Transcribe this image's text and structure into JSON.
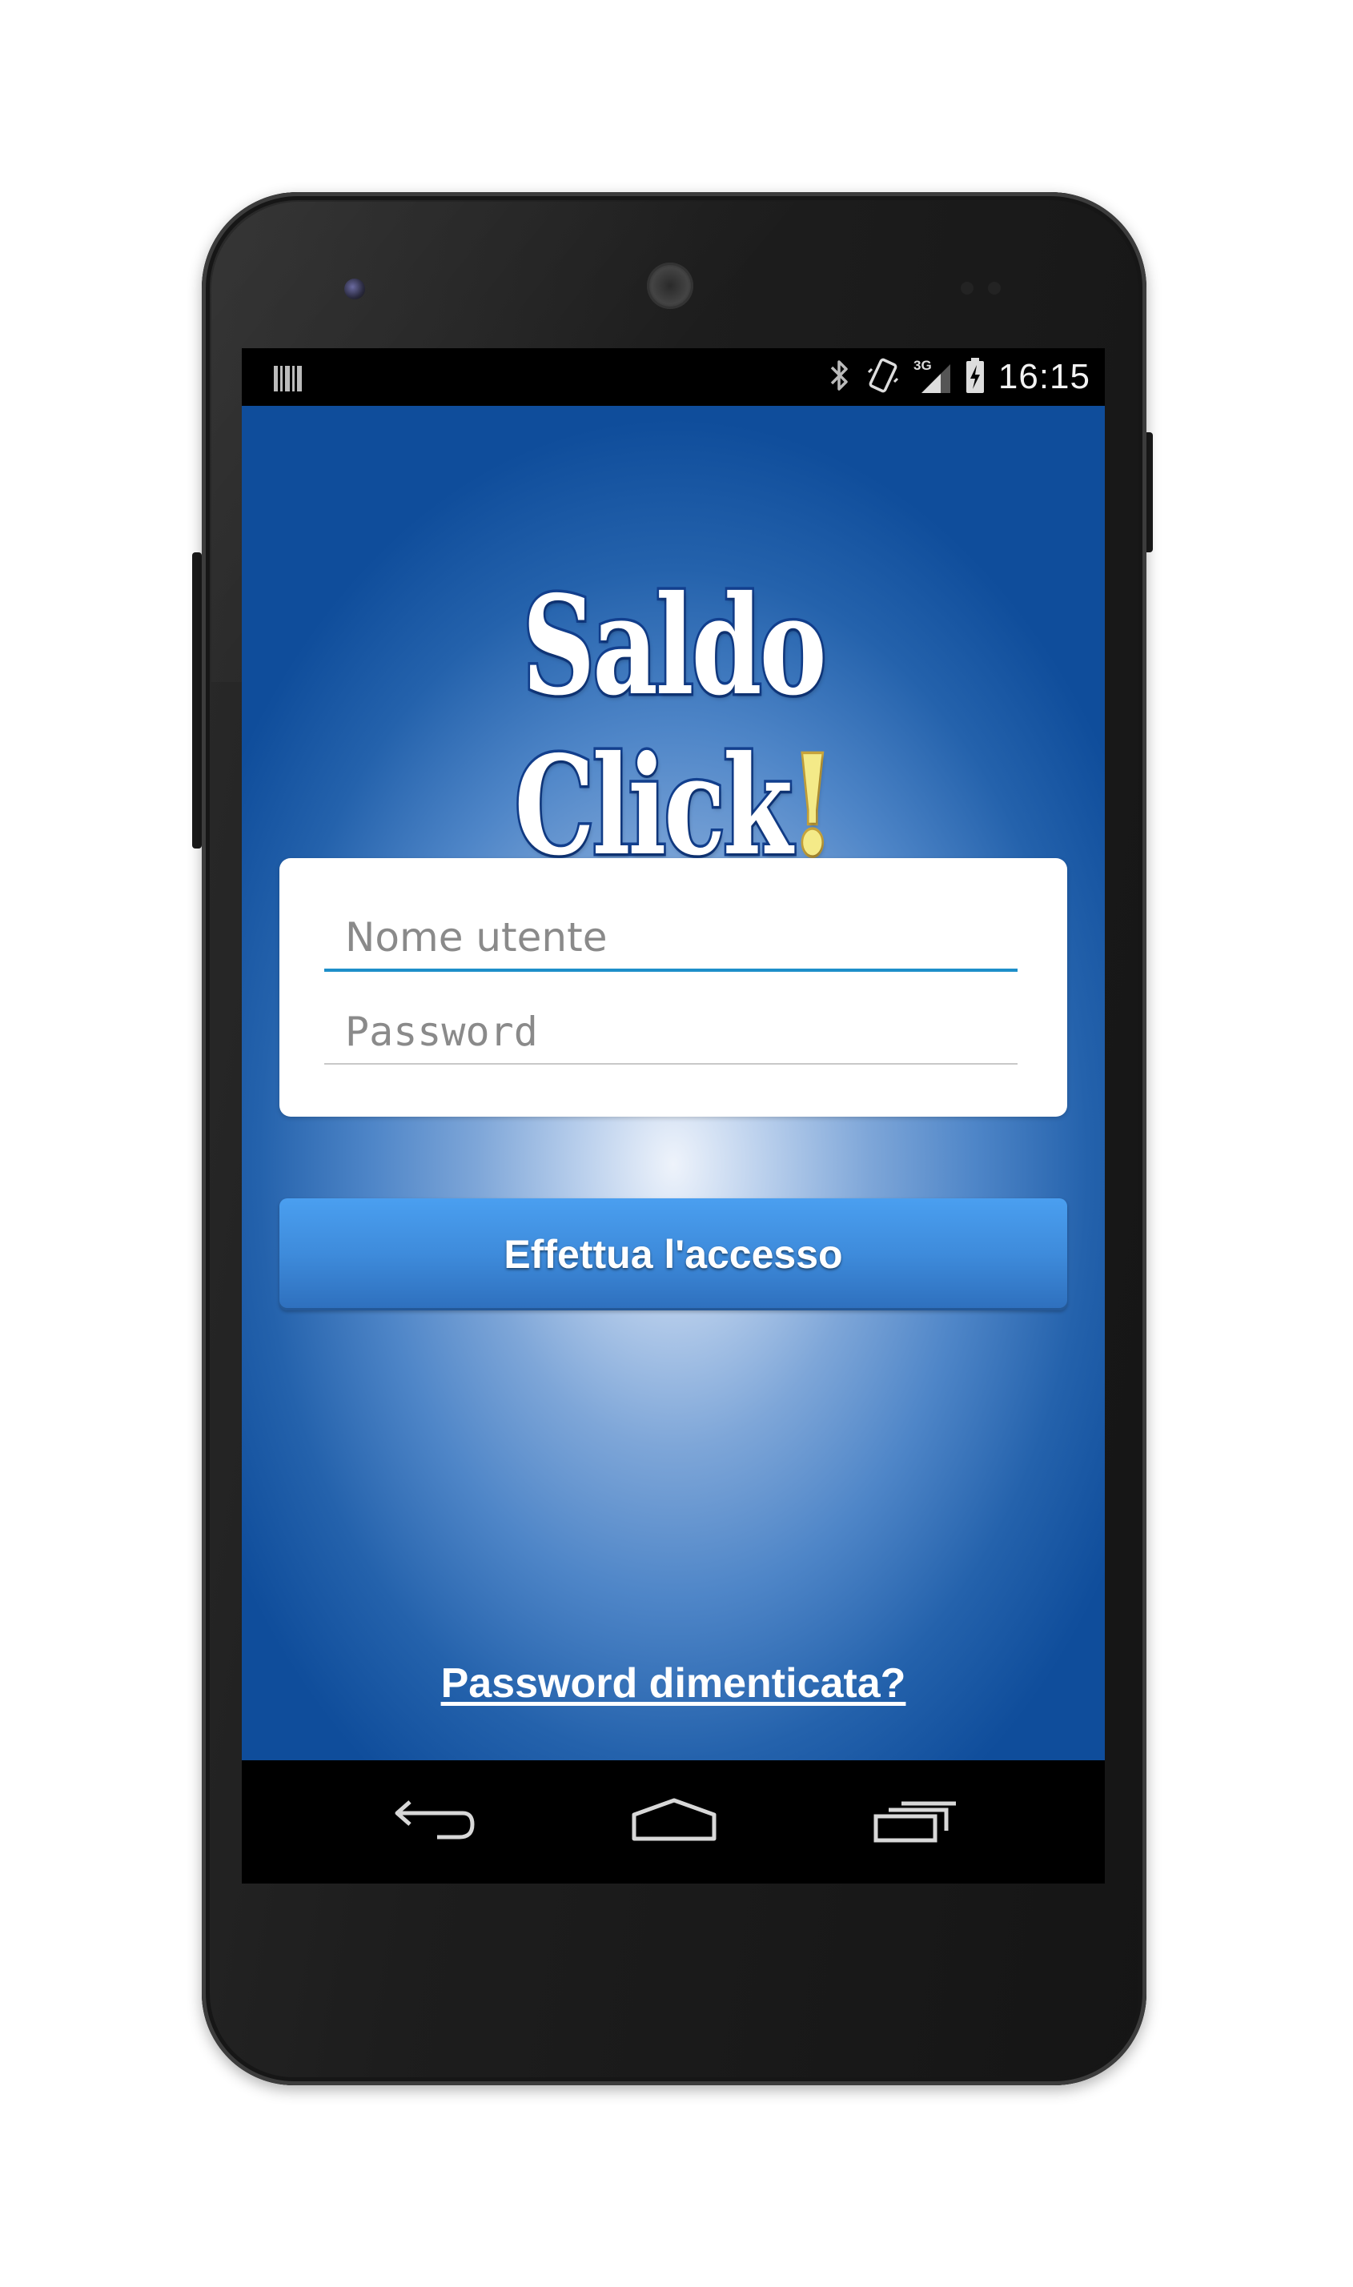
{
  "status_bar": {
    "notification_icon": "barcode-icon",
    "icons": [
      "bluetooth-icon",
      "vibrate-icon",
      "signal-3g-icon",
      "battery-charging-icon"
    ],
    "network_label": "3G",
    "time": "16:15"
  },
  "app": {
    "logo_text": "Saldo Click",
    "logo_exclamation": "!",
    "username_placeholder": "Nome utente",
    "password_placeholder": "Password",
    "login_button_label": "Effettua l'accesso",
    "forgot_password_link": "Password dimenticata?"
  },
  "nav_bar": {
    "buttons": [
      "back-icon",
      "home-icon",
      "recent-apps-icon"
    ]
  },
  "colors": {
    "accent_blue": "#1e8fc9",
    "button_blue": "#3e8bdb",
    "background_dark_blue": "#0f4d9b",
    "logo_exclamation": "#f4ea88"
  }
}
